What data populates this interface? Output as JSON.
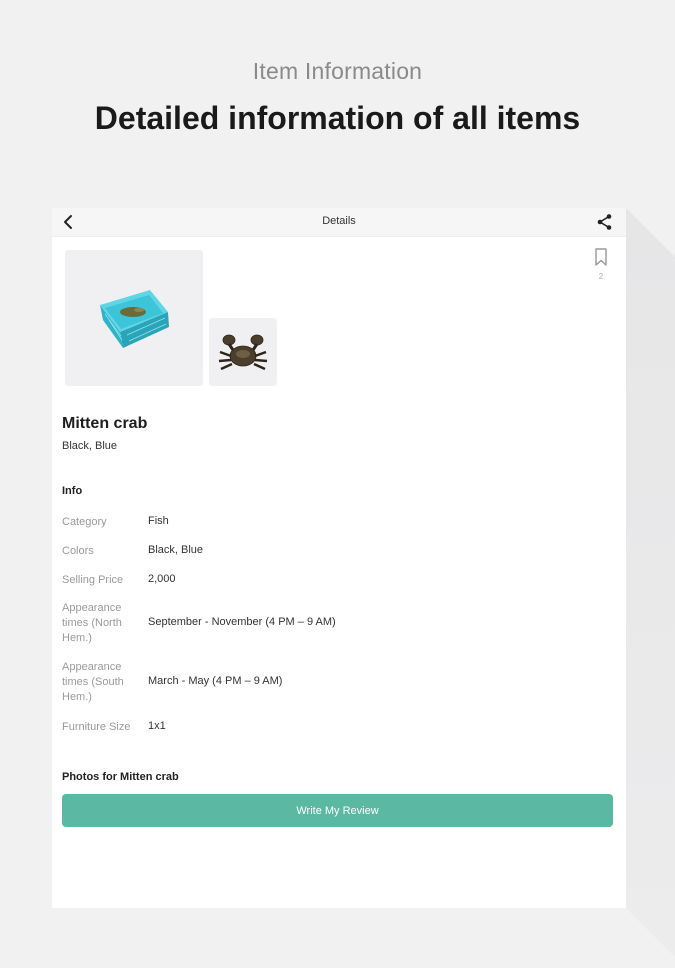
{
  "promo": {
    "subtitle": "Item Information",
    "title": "Detailed information of all items"
  },
  "appbar": {
    "title": "Details",
    "back_icon": "chevron-left-icon",
    "share_icon": "share-icon"
  },
  "bookmark": {
    "icon": "bookmark-icon",
    "count": "2"
  },
  "item": {
    "name": "Mitten crab",
    "colors": "Black, Blue"
  },
  "info": {
    "heading": "Info",
    "rows": [
      {
        "label": "Category",
        "value": "Fish"
      },
      {
        "label": "Colors",
        "value": "Black, Blue"
      },
      {
        "label": "Selling Price",
        "value": "2,000"
      },
      {
        "label": "Appearance times (North Hem.)",
        "value": "September - November (4 PM – 9 AM)"
      },
      {
        "label": "Appearance times (South Hem.)",
        "value": "March - May (4 PM – 9 AM)"
      },
      {
        "label": "Furniture Size",
        "value": "1x1"
      }
    ]
  },
  "photos": {
    "heading": "Photos for Mitten crab",
    "review_button": "Write My Review"
  },
  "colors": {
    "accent": "#5bb8a2",
    "tank": "#3cc4d8",
    "crab": "#4a3f2c"
  }
}
